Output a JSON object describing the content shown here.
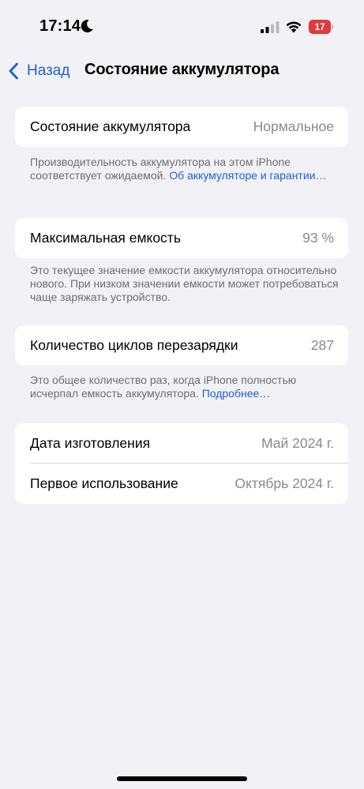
{
  "status_bar": {
    "time": "17:14",
    "battery_level": "17",
    "battery_color": "#e2393c",
    "icons": [
      "moon-icon",
      "signal-icon",
      "wifi-icon",
      "battery-icon"
    ]
  },
  "nav": {
    "back_label": "Назад",
    "title": "Состояние аккумулятора"
  },
  "battery_health": {
    "label": "Состояние аккумулятора",
    "value": "Нормальное",
    "footnote_text": "Производительность аккумулятора на этом iPhone соответствует ожидаемой. ",
    "footnote_link": "Об аккумуляторе и гарантии…"
  },
  "max_capacity": {
    "label": "Максимальная емкость",
    "value": "93 %",
    "footnote_text": "Это текущее значение емкости аккумулятора относительно нового. При низком значении емкости может потребоваться чаще заряжать устройство."
  },
  "cycle_count": {
    "label": "Количество циклов перезарядки",
    "value": "287",
    "footnote_text": "Это общее количество раз, когда iPhone полностью исчерпал емкость аккумулятора. ",
    "footnote_link": "Подробнее…"
  },
  "dates": {
    "manufacture_label": "Дата изготовления",
    "manufacture_value": "Май 2024 г.",
    "first_use_label": "Первое использование",
    "first_use_value": "Октябрь 2024 г."
  },
  "colors": {
    "link": "#1f5ed8",
    "background": "#f2f1f6",
    "secondary_text": "#8a8a8e"
  }
}
